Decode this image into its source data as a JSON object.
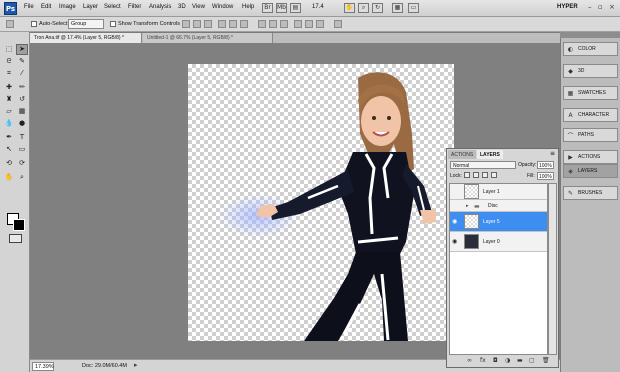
{
  "app": {
    "logo": "Ps",
    "menus": [
      "File",
      "Edit",
      "Image",
      "Layer",
      "Select",
      "Filter",
      "Analysis",
      "3D",
      "View",
      "Window",
      "Help"
    ],
    "zoom_readout": "17.4",
    "workspace": "HYPER"
  },
  "options_bar": {
    "auto_select_label": "Auto-Select:",
    "auto_select_value": "Group",
    "show_transform_label": "Show Transform Controls"
  },
  "tabs": [
    {
      "label": "Tron Ana.tif @ 17.4% (Layer 5, RGB/8) *"
    },
    {
      "label": "Untitled-1 @ 66.7% (Layer 5, RGB/8) *"
    }
  ],
  "status": {
    "zoom": "17.39%",
    "doc": "Doc: 29.0M/60.4M"
  },
  "dock": [
    {
      "label": "COLOR",
      "icon": "color-icon"
    },
    {
      "label": "3D",
      "icon": "3d-icon"
    },
    {
      "label": "SWATCHES",
      "icon": "swatches-icon"
    },
    {
      "label": "CHARACTER",
      "icon": "character-icon"
    },
    {
      "label": "PATHS",
      "icon": "paths-icon"
    },
    {
      "label": "ACTIONS",
      "icon": "actions-icon"
    },
    {
      "label": "LAYERS",
      "icon": "layers-icon"
    },
    {
      "label": "BRUSHES",
      "icon": "brushes-icon"
    }
  ],
  "layers_panel": {
    "tabs": [
      "ACTIONS",
      "LAYERS"
    ],
    "blend_mode": "Normal",
    "opacity_label": "Opacity:",
    "opacity_value": "100%",
    "lock_label": "Lock:",
    "fill_label": "Fill:",
    "fill_value": "100%",
    "layers": [
      {
        "name": "Layer 1",
        "visible": false,
        "selected": false
      },
      {
        "name": "Disc",
        "visible": false,
        "selected": false
      },
      {
        "name": "Layer 5",
        "visible": true,
        "selected": true
      },
      {
        "name": "Layer 0",
        "visible": true,
        "selected": false
      }
    ]
  },
  "colors": {
    "selection": "#3d8ef0",
    "ps_blue": "#1e5aa8",
    "suit": "#10131f",
    "glow": "#ffffff"
  }
}
